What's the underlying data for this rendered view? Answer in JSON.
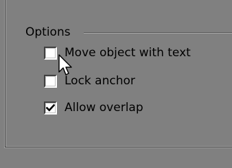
{
  "group": {
    "title": "Options"
  },
  "options": [
    {
      "label": "Move object with text",
      "checked": false
    },
    {
      "label": "Lock anchor",
      "checked": false
    },
    {
      "label": "Allow overlap",
      "checked": true
    }
  ],
  "icons": {
    "checkmark": "check-icon",
    "cursor": "arrow-cursor-icon"
  },
  "colors": {
    "background": "#808080",
    "checkbox_fill": "#ffffff",
    "text": "#000000"
  }
}
